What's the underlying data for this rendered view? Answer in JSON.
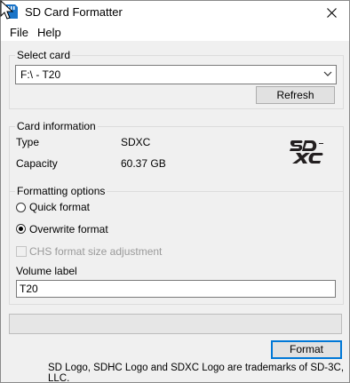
{
  "window": {
    "title": "SD Card Formatter"
  },
  "menu": {
    "items": [
      "File",
      "Help"
    ]
  },
  "select_card": {
    "group_label": "Select card",
    "selected": "F:\\ - T20",
    "refresh_label": "Refresh"
  },
  "card_info": {
    "group_label": "Card information",
    "type_label": "Type",
    "type_value": "SDXC",
    "capacity_label": "Capacity",
    "capacity_value": "60.37 GB"
  },
  "formatting": {
    "group_label": "Formatting options",
    "quick_label": "Quick format",
    "quick_checked": false,
    "overwrite_label": "Overwrite format",
    "overwrite_checked": true,
    "chs_label": "CHS format size adjustment",
    "chs_enabled": false,
    "volume_label_caption": "Volume label",
    "volume_label_value": "T20"
  },
  "progress": {
    "value": 0
  },
  "actions": {
    "format_label": "Format"
  },
  "footer": {
    "trademark": "SD Logo, SDHC Logo and SDXC Logo are trademarks of SD-3C, LLC."
  },
  "colors": {
    "accent": "#0078d7",
    "logo": "#231f20"
  }
}
